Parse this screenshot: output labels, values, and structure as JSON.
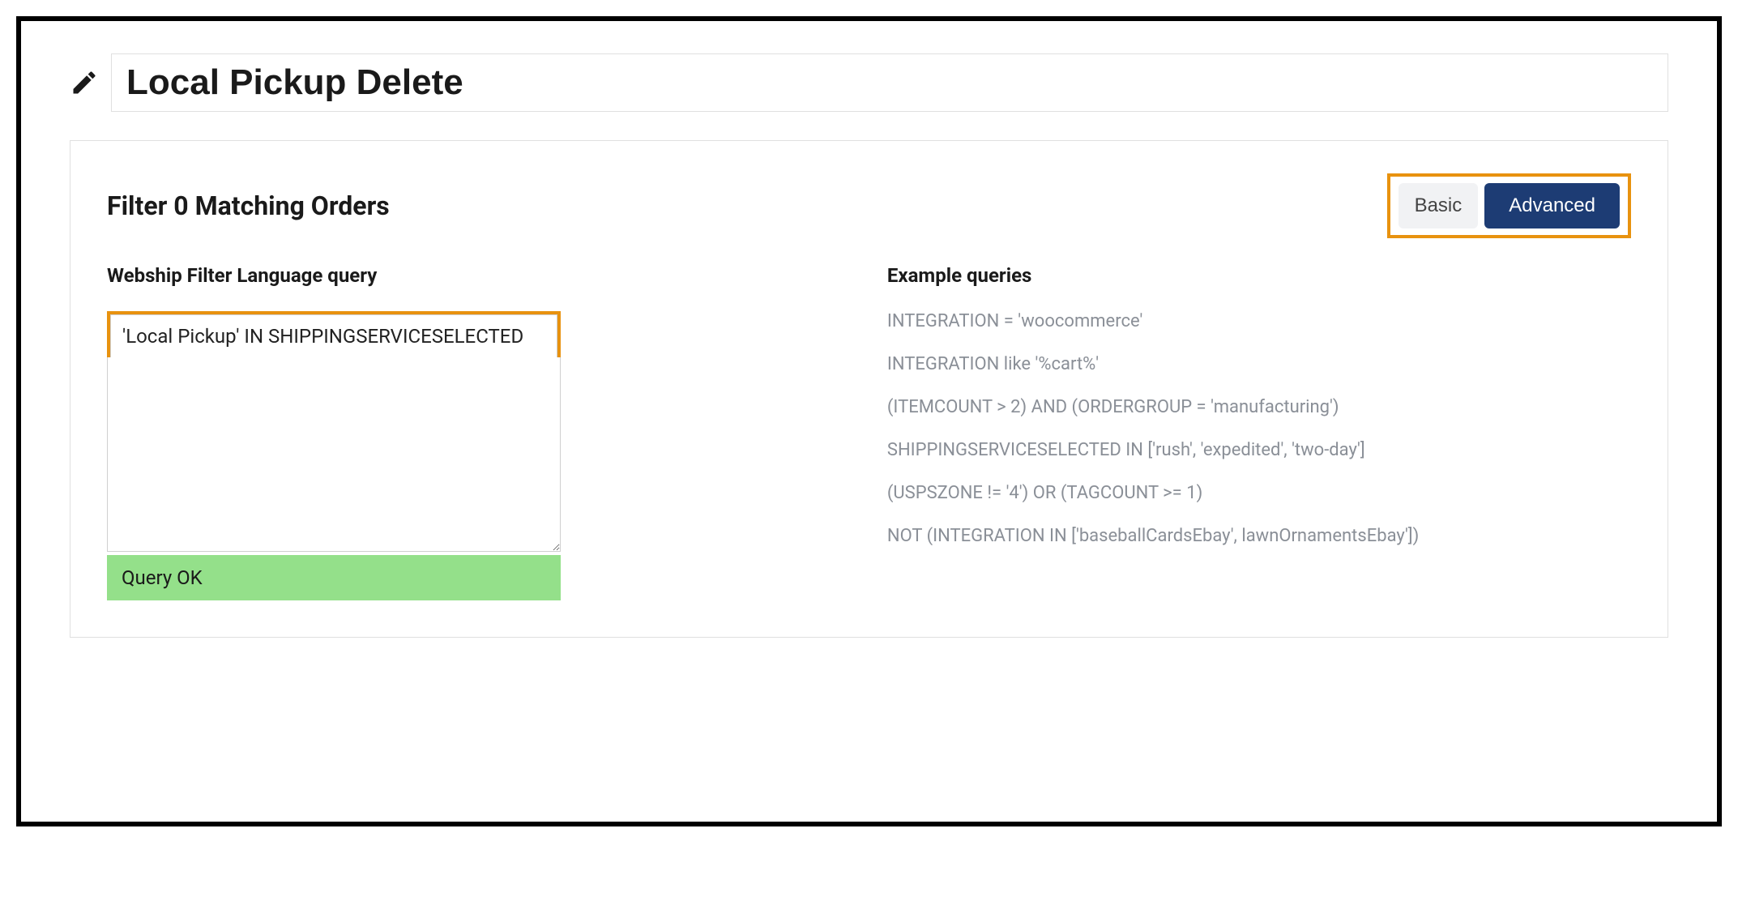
{
  "title": "Local Pickup Delete",
  "filter_heading": "Filter 0 Matching Orders",
  "toggle": {
    "basic_label": "Basic",
    "advanced_label": "Advanced"
  },
  "query": {
    "label": "Webship Filter Language query",
    "value": "'Local Pickup' IN SHIPPINGSERVICESELECTED",
    "status": "Query OK"
  },
  "examples": {
    "label": "Example queries",
    "items": [
      "INTEGRATION = 'woocommerce'",
      "INTEGRATION like '%cart%'",
      "(ITEMCOUNT > 2) AND (ORDERGROUP = 'manufacturing')",
      "SHIPPINGSERVICESELECTED IN ['rush', 'expedited', 'two-day']",
      "(USPSZONE != '4') OR (TAGCOUNT >= 1)",
      "NOT (INTEGRATION IN ['baseballCardsEbay', lawnOrnamentsEbay'])"
    ]
  },
  "colors": {
    "highlight_border": "#e8920f",
    "primary_button": "#1d3c74",
    "status_ok_bg": "#94e08a"
  }
}
